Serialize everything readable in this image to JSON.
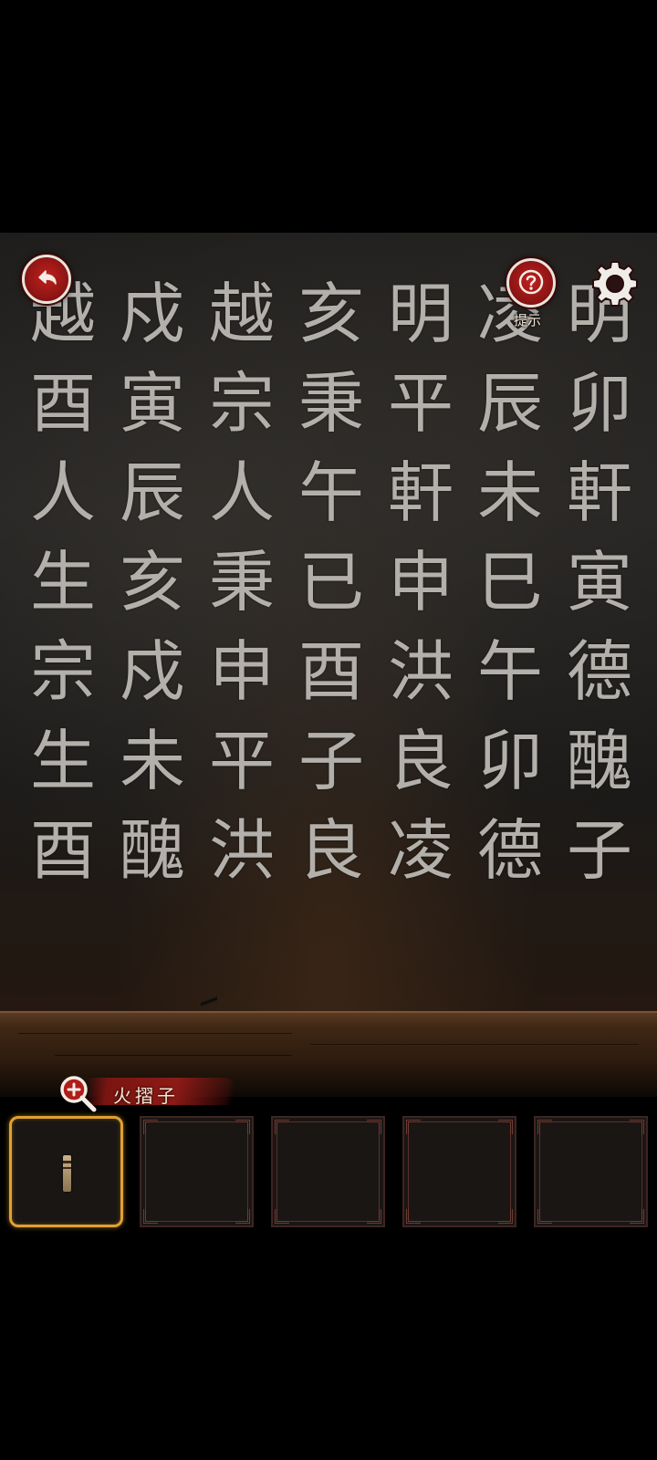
{
  "scene": {
    "grid_rows": [
      [
        "越",
        "戍",
        "越",
        "亥",
        "明",
        "凌",
        "明"
      ],
      [
        "酉",
        "寅",
        "宗",
        "秉",
        "平",
        "辰",
        "卯"
      ],
      [
        "人",
        "辰",
        "人",
        "午",
        "軒",
        "未",
        "軒"
      ],
      [
        "生",
        "亥",
        "秉",
        "已",
        "申",
        "巳",
        "寅"
      ],
      [
        "宗",
        "戍",
        "申",
        "酉",
        "洪",
        "午",
        "德"
      ],
      [
        "生",
        "未",
        "平",
        "子",
        "良",
        "卯",
        "醜"
      ],
      [
        "酉",
        "醜",
        "洪",
        "良",
        "凌",
        "德",
        "子"
      ]
    ],
    "character_color": "#b3b0ab"
  },
  "toolbar": {
    "back_icon": "back-arrow-icon",
    "hint_icon": "question-icon",
    "hint_label": "提示",
    "settings_icon": "gear-icon",
    "accent_color": "#a81a18"
  },
  "inventory": {
    "selected_item_name": "火摺子",
    "zoom_icon": "zoom-in-icon",
    "slots": [
      {
        "item": "firestarter",
        "selected": true
      },
      {
        "item": null,
        "selected": false
      },
      {
        "item": null,
        "selected": false
      },
      {
        "item": null,
        "selected": false
      },
      {
        "item": null,
        "selected": false
      }
    ],
    "selected_color": "#e0a030"
  }
}
